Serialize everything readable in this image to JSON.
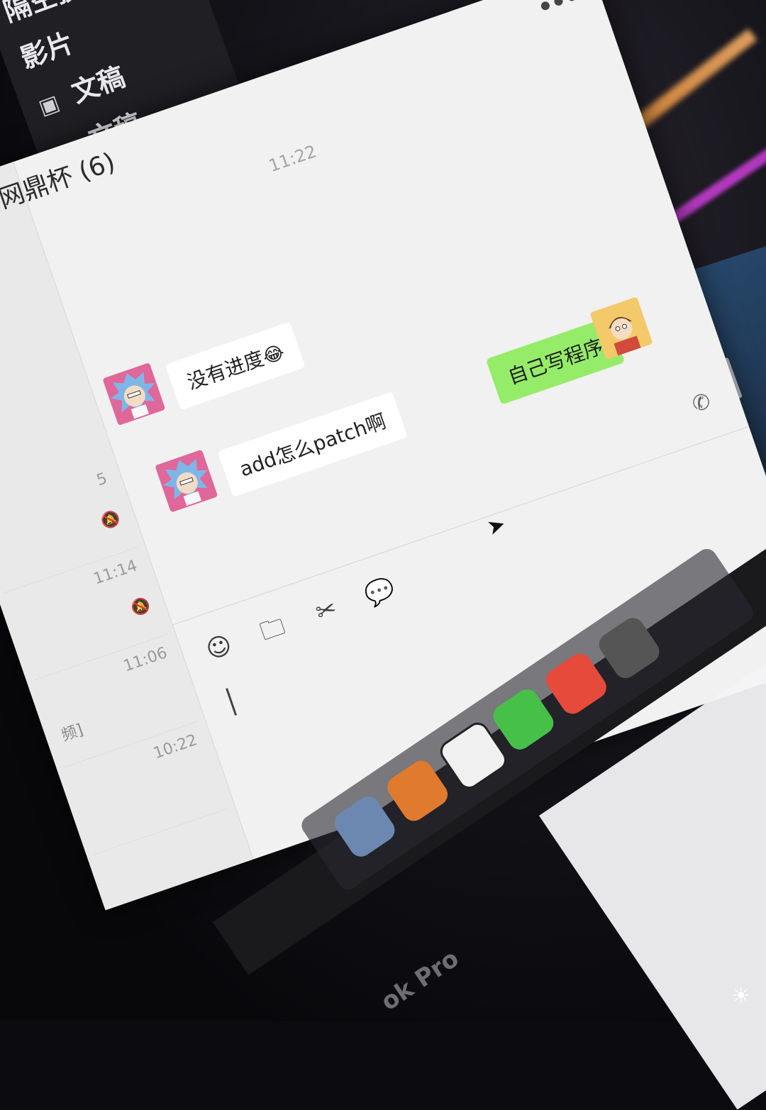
{
  "finder_sidebar": {
    "items": [
      {
        "label": "隔空投送",
        "icon": "airdrop-icon"
      },
      {
        "label": "影片",
        "icon": "film-icon"
      },
      {
        "label": "文稿",
        "icon": "document-icon"
      },
      {
        "label": "文稿",
        "icon": "home-icon"
      }
    ]
  },
  "chat": {
    "title": "网鼎杯 (6)",
    "more_label": "•••",
    "timestamp": "11:22",
    "messages": [
      {
        "sender": "rick",
        "side": "in",
        "text": "没有进度",
        "emoji": "😂"
      },
      {
        "sender": "rick",
        "side": "in",
        "text": "add怎么patch啊"
      },
      {
        "sender": "morty",
        "side": "out",
        "text": "自己写程序"
      }
    ],
    "toolbar": [
      {
        "name": "emoji-icon",
        "glyph": "☺"
      },
      {
        "name": "folder-icon",
        "glyph": "🗀"
      },
      {
        "name": "scissors-icon",
        "glyph": "✂"
      },
      {
        "name": "chat-bubble-icon",
        "glyph": "💬"
      }
    ],
    "call_glyph": "✆"
  },
  "conversation_list": {
    "rows": [
      {
        "time": "5",
        "snippet": ""
      },
      {
        "time": "11:14",
        "snippet": ""
      },
      {
        "time": "11:06",
        "snippet": "频]"
      },
      {
        "time": "10:22",
        "snippet": ""
      }
    ]
  },
  "laptop_label": "ok Pro",
  "colors": {
    "outgoing_bubble": "#95ec69",
    "incoming_bubble": "#ffffff",
    "window_bg": "#f1f1f1",
    "rick_avatar": "#e0679a",
    "morty_avatar": "#f4c969"
  }
}
